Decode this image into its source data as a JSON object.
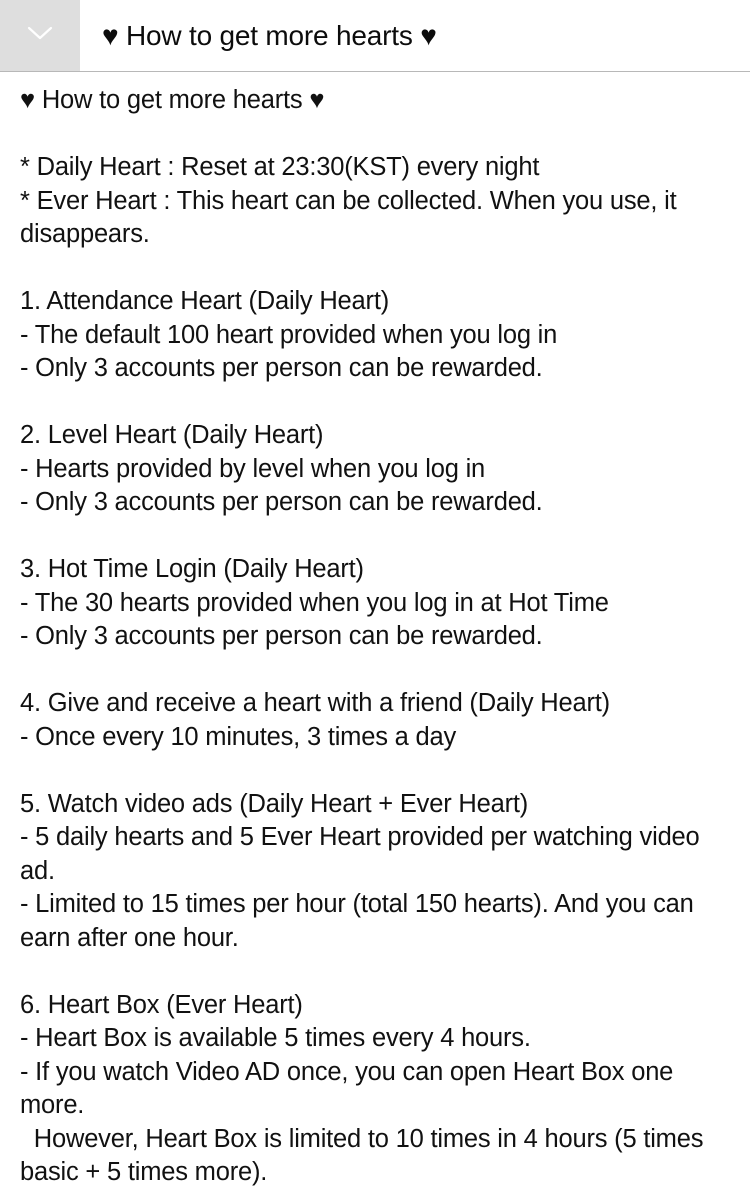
{
  "header": {
    "title": "♥ How to get more hearts ♥",
    "collapse_icon": "chevron-down-icon",
    "collapse_bg": "#dedede"
  },
  "content": {
    "title": "♥ How to get more hearts ♥",
    "notes": [
      "* Daily Heart : Reset at 23:30(KST) every night",
      "* Ever Heart : This heart can be collected. When you use, it disappears."
    ],
    "sections": [
      {
        "heading": "1. Attendance Heart (Daily Heart)",
        "lines": [
          "- The default 100 heart provided when you log in",
          "- Only 3 accounts per person can be rewarded."
        ]
      },
      {
        "heading": "2. Level Heart (Daily Heart)",
        "lines": [
          "- Hearts provided by level when you log in",
          "- Only 3 accounts per person can be rewarded."
        ]
      },
      {
        "heading": "3. Hot Time Login (Daily Heart)",
        "lines": [
          "- The 30 hearts provided when you log in at Hot Time",
          "- Only 3 accounts per person can be rewarded."
        ]
      },
      {
        "heading": "4. Give and receive a heart with a friend (Daily Heart)",
        "lines": [
          "- Once every 10 minutes, 3 times a day"
        ]
      },
      {
        "heading": "5. Watch video ads (Daily Heart + Ever Heart)",
        "lines": [
          "- 5 daily hearts and 5 Ever Heart provided per watching video ad.",
          "- Limited to 15 times per hour (total 150 hearts). And you can earn after one hour."
        ]
      },
      {
        "heading": "6. Heart Box (Ever Heart)",
        "lines": [
          "- Heart Box is available 5 times every 4 hours.",
          "- If you watch Video AD once, you can open Heart Box one more.",
          "  However, Heart Box is limited to 10 times in 4 hours (5 times basic + 5 times more)."
        ]
      }
    ]
  }
}
